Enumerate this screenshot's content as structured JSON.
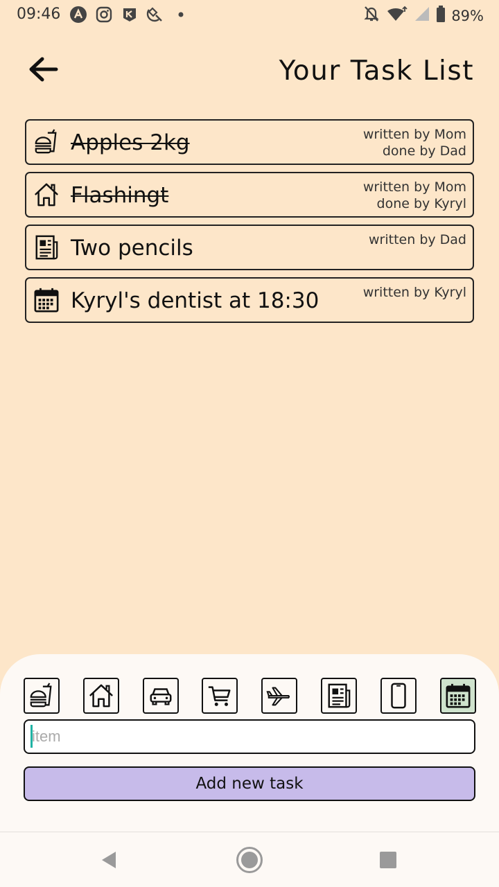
{
  "status_bar": {
    "time": "09:46",
    "battery_percent": "89%",
    "icons": [
      "app-a-icon",
      "instagram-icon",
      "kyiv-app-icon",
      "satellite-icon",
      "dot-icon",
      "bell-off-icon",
      "wifi-icon",
      "signal-icon",
      "battery-icon"
    ]
  },
  "header": {
    "title": "Your Task List",
    "back_icon": "arrow-left-icon"
  },
  "tasks": [
    {
      "title": "Apples 2kg",
      "icon": "food-icon",
      "done": true,
      "meta_line1": "written by Mom",
      "meta_line2": "done by Dad"
    },
    {
      "title": "Flashingt",
      "icon": "home-icon",
      "done": true,
      "meta_line1": "written by Mom",
      "meta_line2": "done by Kyryl"
    },
    {
      "title": "Two pencils",
      "icon": "newspaper-icon",
      "done": false,
      "meta_line1": "written by Dad",
      "meta_line2": ""
    },
    {
      "title": "Kyryl's dentist at 18:30",
      "icon": "calendar-icon",
      "done": false,
      "meta_line1": "written by Kyryl",
      "meta_line2": ""
    }
  ],
  "composer": {
    "categories": [
      "food-icon",
      "home-icon",
      "car-icon",
      "cart-icon",
      "plane-icon",
      "newspaper-icon",
      "phone-icon",
      "calendar-icon"
    ],
    "selected_category": "calendar-icon",
    "input_placeholder": "item",
    "input_value": "",
    "add_button_label": "Add new task"
  },
  "colors": {
    "background": "#fde6c9",
    "sheet": "#fdf9f5",
    "add_button": "#c7bbea",
    "selected_category": "#cfe3cd",
    "caret": "#1fb3a4"
  },
  "nav_bar": {
    "buttons": [
      "back-triangle-icon",
      "home-circle-icon",
      "recents-square-icon"
    ]
  }
}
